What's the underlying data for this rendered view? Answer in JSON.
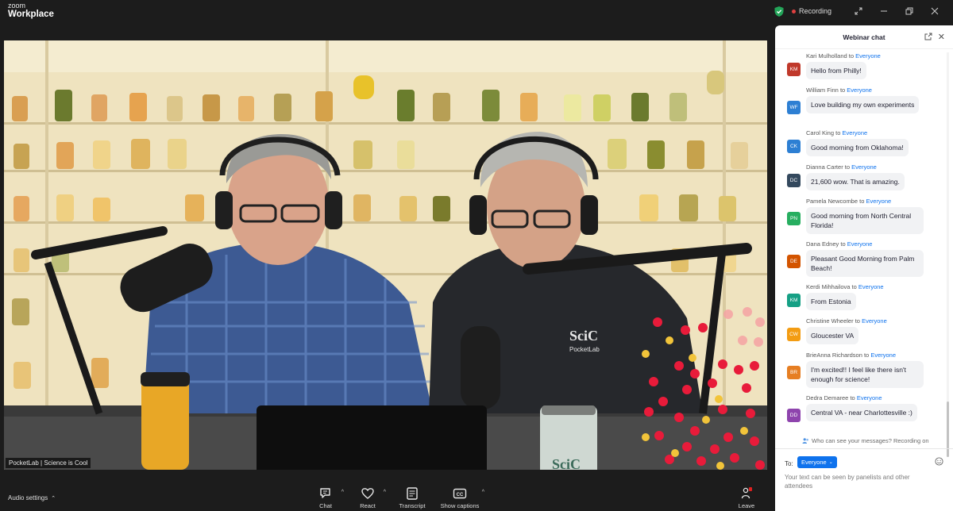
{
  "app": {
    "brand_small": "zoom",
    "brand_name": "Workplace"
  },
  "titlebar": {
    "recording_label": "Recording"
  },
  "video": {
    "label": "PocketLab | Science is Cool"
  },
  "toolbar": {
    "audio_settings": "Audio settings",
    "chat": "Chat",
    "react": "React",
    "transcript": "Transcript",
    "show_captions": "Show captions",
    "leave": "Leave"
  },
  "chat": {
    "title": "Webinar chat",
    "to_word": "to",
    "messages": [
      {
        "initials": "KM",
        "sender": "Kari Mulholland",
        "recipient": "Everyone",
        "text": "Hello from Philly!",
        "color": "#c0392b"
      },
      {
        "initials": "WF",
        "sender": "William Finn",
        "recipient": "Everyone",
        "text": "Love building my own experiments",
        "color": "#2d7fd3"
      },
      {
        "initials": "CK",
        "sender": "Carol King",
        "recipient": "Everyone",
        "text": "Good morning from Oklahoma!",
        "color": "#2d7fd3"
      },
      {
        "initials": "DC",
        "sender": "Dianna Carter",
        "recipient": "Everyone",
        "text": "21,600 wow. That is amazing.",
        "color": "#34495e"
      },
      {
        "initials": "PN",
        "sender": "Pamela Newcombe",
        "recipient": "Everyone",
        "text": "Good morning from North Central Florida!",
        "color": "#27ae60"
      },
      {
        "initials": "DE",
        "sender": "Dana Edney",
        "recipient": "Everyone",
        "text": "Pleasant Good Morning from Palm Beach!",
        "color": "#d35400"
      },
      {
        "initials": "KM",
        "sender": "Kerdi Mihhailova",
        "recipient": "Everyone",
        "text": "From Estonia",
        "color": "#16a085"
      },
      {
        "initials": "CW",
        "sender": "Christine Wheeler",
        "recipient": "Everyone",
        "text": "Gloucester VA",
        "color": "#f39c12"
      },
      {
        "initials": "BR",
        "sender": "BrieAnna Richardson",
        "recipient": "Everyone",
        "text": "I'm excited!! I feel like there isn't enough for science!",
        "color": "#e67e22"
      },
      {
        "initials": "DD",
        "sender": "Dedra Demaree",
        "recipient": "Everyone",
        "text": "Central VA - near Charlottesville :)",
        "color": "#8e44ad"
      }
    ],
    "notice": "Who can see your messages? Recording on",
    "to_label": "To:",
    "recipient_select": "Everyone",
    "input_placeholder": "Your text can be seen by panelists and other attendees"
  }
}
